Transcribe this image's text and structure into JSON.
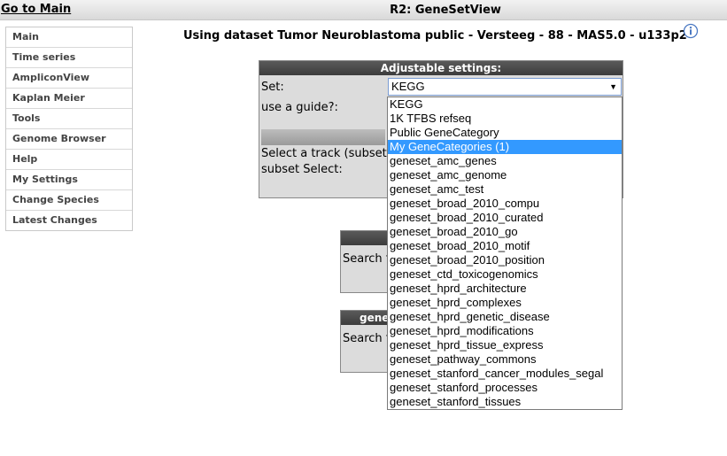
{
  "topbar": {
    "go_to_main": "Go to Main",
    "title": "R2: GeneSetView"
  },
  "sidebar": {
    "items": [
      {
        "label": "Main"
      },
      {
        "label": "Time series"
      },
      {
        "label": "AmpliconView"
      },
      {
        "label": "Kaplan Meier"
      },
      {
        "label": "Tools"
      },
      {
        "label": "Genome Browser"
      },
      {
        "label": "Help"
      },
      {
        "label": "My Settings"
      },
      {
        "label": "Change Species"
      },
      {
        "label": "Latest Changes"
      }
    ]
  },
  "dataset": {
    "text": "Using dataset Tumor Neuroblastoma public - Versteeg - 88 - MAS5.0 - u133p2",
    "info_icon": "info-icon"
  },
  "settings": {
    "header": "Adjustable settings:",
    "set_label": "Set:",
    "set_value": "KEGG",
    "guide_label": "use a guide?:",
    "track_label": "Select a track (subset)",
    "subset_label": "subset Select:"
  },
  "panel1": {
    "header": "",
    "search_label": "Search f"
  },
  "panel2": {
    "header": "gene",
    "search_label": "Search f"
  },
  "dropdown": {
    "selected_index": 3,
    "options": [
      "KEGG",
      "1K TFBS refseq",
      "Public GeneCategory",
      "My GeneCategories (1)",
      "geneset_amc_genes",
      "geneset_amc_genome",
      "geneset_amc_test",
      "geneset_broad_2010_compu",
      "geneset_broad_2010_curated",
      "geneset_broad_2010_go",
      "geneset_broad_2010_motif",
      "geneset_broad_2010_position",
      "geneset_ctd_toxicogenomics",
      "geneset_hprd_architecture",
      "geneset_hprd_complexes",
      "geneset_hprd_genetic_disease",
      "geneset_hprd_modifications",
      "geneset_hprd_tissue_express",
      "geneset_pathway_commons",
      "geneset_stanford_cancer_modules_segal",
      "geneset_stanford_processes",
      "geneset_stanford_tissues"
    ]
  },
  "colors": {
    "highlight": "#3399ff",
    "panel_header": "#4a4a4a"
  }
}
